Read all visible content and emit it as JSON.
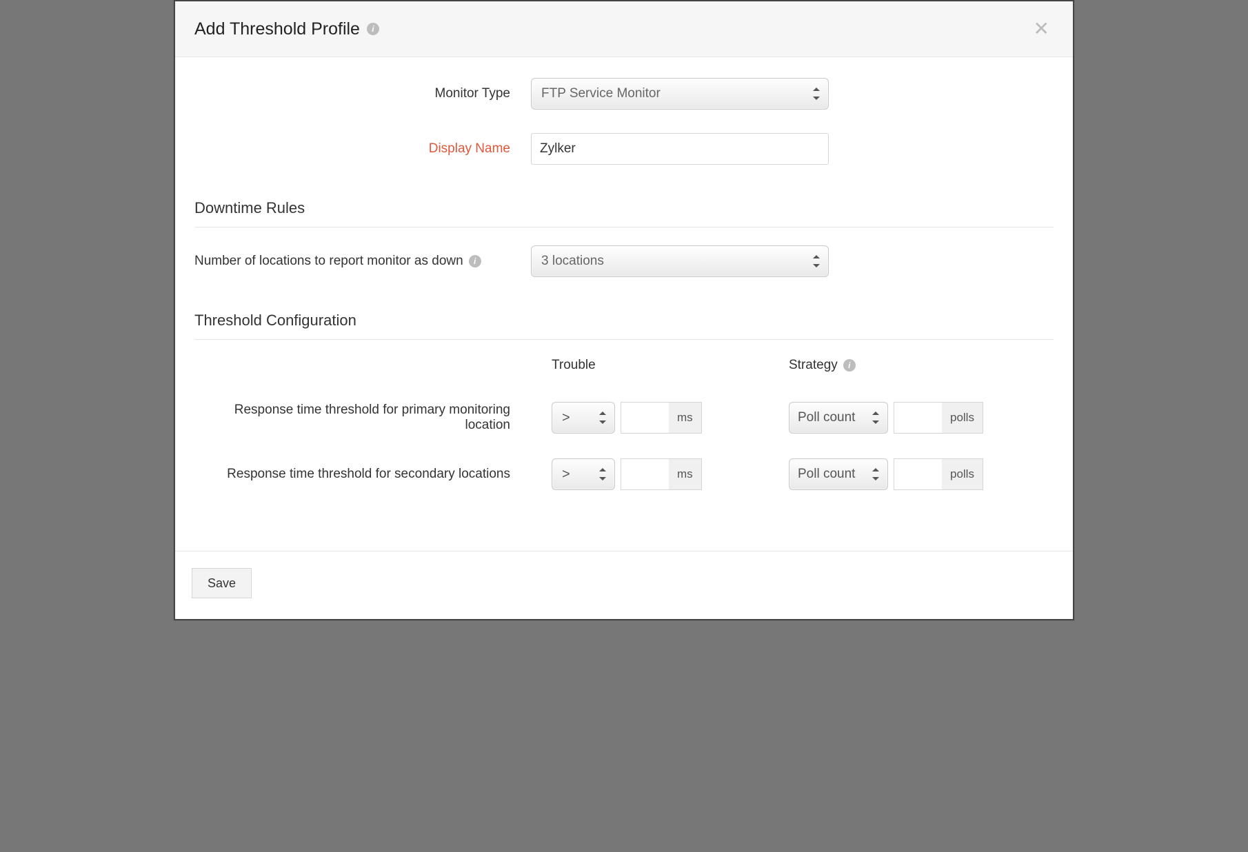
{
  "header": {
    "title": "Add Threshold Profile"
  },
  "form": {
    "monitor_type_label": "Monitor Type",
    "monitor_type_value": "FTP Service Monitor",
    "display_name_label": "Display Name",
    "display_name_value": "Zylker"
  },
  "sections": {
    "downtime": {
      "title": "Downtime Rules",
      "locations_label": "Number of locations to report monitor as down",
      "locations_value": "3 locations"
    },
    "threshold": {
      "title": "Threshold Configuration",
      "col_trouble": "Trouble",
      "col_strategy": "Strategy",
      "rows": {
        "primary": {
          "label": "Response time threshold for primary monitoring location",
          "op": ">",
          "value": "",
          "unit": "ms",
          "strategy": "Poll count",
          "polls_value": "",
          "polls_unit": "polls"
        },
        "secondary": {
          "label": "Response time threshold for secondary locations",
          "op": ">",
          "value": "",
          "unit": "ms",
          "strategy": "Poll count",
          "polls_value": "",
          "polls_unit": "polls"
        }
      }
    }
  },
  "footer": {
    "save": "Save"
  },
  "icons": {
    "info": "i",
    "close": "✕"
  }
}
